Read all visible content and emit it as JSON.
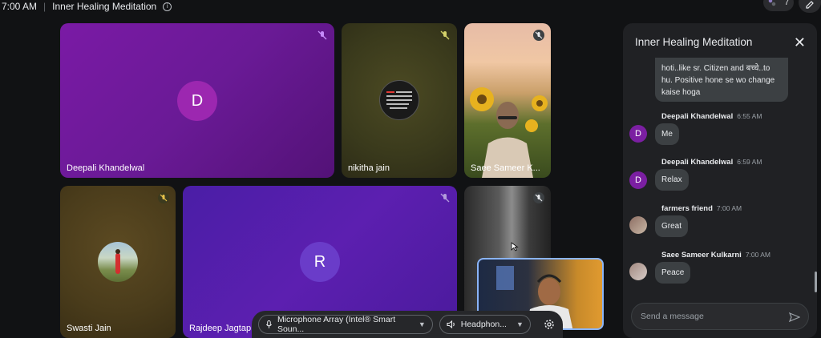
{
  "topbar": {
    "time": "7:00 AM",
    "meeting_title": "Inner Healing Meditation",
    "people_count": "7"
  },
  "tiles": [
    {
      "name": "Deepali Khandelwal",
      "initial": "D"
    },
    {
      "name": "nikitha jain"
    },
    {
      "name": "Saee Sameer K..."
    },
    {
      "name": "Swasti Jain"
    },
    {
      "name": "Rajdeep Jagtap",
      "initial": "R"
    },
    {
      "name": ""
    }
  ],
  "controls": {
    "mic_label": "Microphone Array (Intel® Smart Soun...",
    "speaker_label": "Headphon..."
  },
  "chat": {
    "title": "Inner Healing Meditation",
    "first_bubble": "hoti..like sr. Citizen and बच्चे..to hu. Positive hone se wo change kaise hoga",
    "messages": [
      {
        "sender": "Deepali Khandelwal",
        "time": "6:55 AM",
        "text": "Me",
        "avatar": "D"
      },
      {
        "sender": "Deepali Khandelwal",
        "time": "6:59 AM",
        "text": "Relax",
        "avatar": "D"
      },
      {
        "sender": "farmers friend",
        "time": "7:00 AM",
        "text": "Great",
        "avatar": ""
      },
      {
        "sender": "Saee Sameer Kulkarni",
        "time": "7:00 AM",
        "text": "Peace",
        "avatar": ""
      }
    ],
    "input_placeholder": "Send a message"
  },
  "colors": {
    "accent": "#8ab4f8",
    "avatar_purple": "#7b1fa2"
  }
}
